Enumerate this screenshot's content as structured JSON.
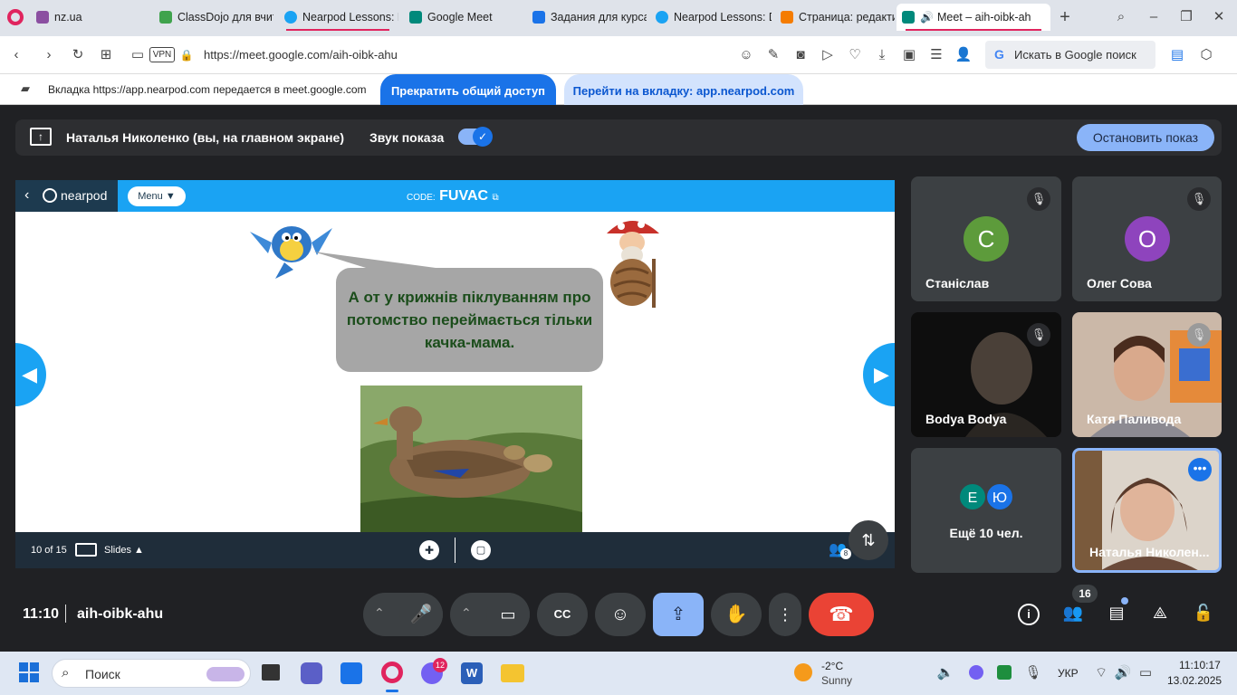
{
  "browser": {
    "tabs": [
      {
        "label": "nz.ua",
        "color": "#8b4fa1"
      },
      {
        "label": "ClassDojo для вчите",
        "color": "#3fa34d"
      },
      {
        "label": "Nearpod Lessons: D",
        "color": "#1aa3f3"
      },
      {
        "label": "Google Meet",
        "color": "#00897b"
      },
      {
        "label": "Задания для курса",
        "color": "#1a73e8"
      },
      {
        "label": "Nearpod Lessons: D",
        "color": "#1aa3f3"
      },
      {
        "label": "Страница: редакти",
        "color": "#f57c00"
      },
      {
        "label": "Meet – aih-oibk-ah",
        "color": "#00897b"
      }
    ],
    "url": "https://meet.google.com/aih-oibk-ahu",
    "vpn_label": "VPN",
    "search_placeholder": "Искать в Google поиск"
  },
  "sharebar": {
    "message": "Вкладка https://app.nearpod.com передается в meet.google.com",
    "stop_label": "Прекратить общий доступ",
    "goto_label": "Перейти на вкладку: app.nearpod.com"
  },
  "presentation_bar": {
    "presenter": "Наталья Николенко (вы, на главном экране)",
    "sound_label": "Звук показа",
    "stop_button": "Остановить показ"
  },
  "nearpod": {
    "logo": "nearpod",
    "menu_label": "Menu ▼",
    "code_label": "CODE:",
    "code_value": "FUVAC",
    "slide_text": "А от у крижнів піклуванням про потомство переймається тільки качка-мама.",
    "slide_counter": "10 of 15",
    "slides_label": "Slides ▲",
    "participants_badge": "8"
  },
  "participants": [
    {
      "name": "Станіслав",
      "initial": "С",
      "color": "#5d9b3b"
    },
    {
      "name": "Олег Сова",
      "initial": "О",
      "color": "#8e44bd"
    },
    {
      "name": "Bodya Bodya"
    },
    {
      "name": "Катя Паливода"
    },
    {
      "name": "Ещё 10 чел.",
      "initials": [
        "Е",
        "Ю"
      ]
    },
    {
      "name": "Наталья Николен..."
    }
  ],
  "meeting": {
    "time": "11:10",
    "code": "aih-oibk-ahu",
    "people_count": "16"
  },
  "taskbar": {
    "search_label": "Поиск",
    "viber_badge": "12",
    "weather_temp": "-2°C",
    "weather_desc": "Sunny",
    "lang": "УКР",
    "clock_time": "11:10:17",
    "clock_date": "13.02.2025"
  }
}
